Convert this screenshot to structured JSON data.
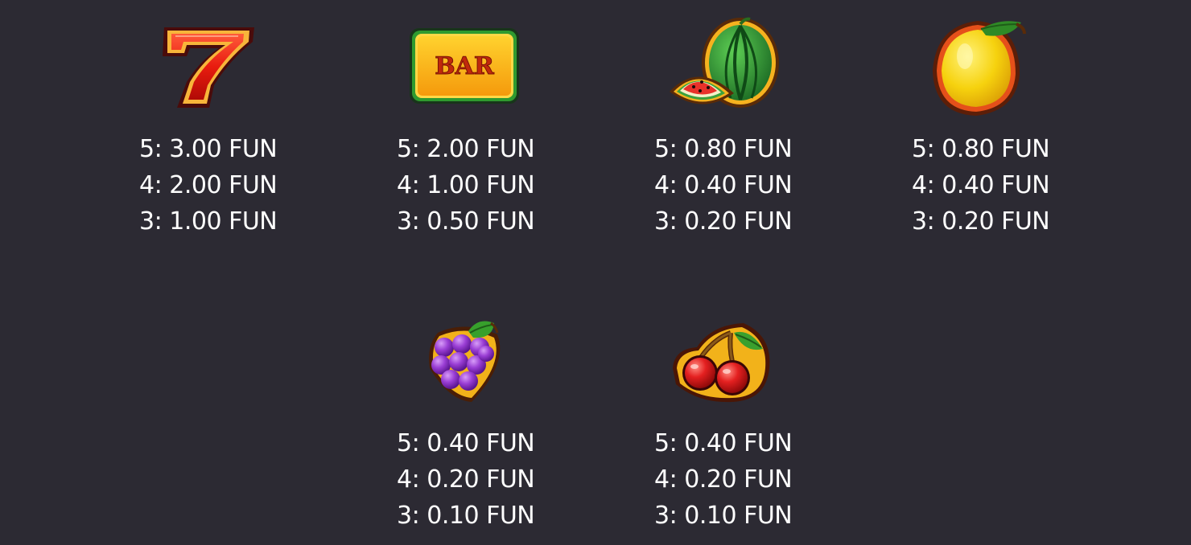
{
  "paytable": {
    "symbols": [
      {
        "icon": "seven-icon",
        "payouts": [
          "5: 3.00 FUN",
          "4: 2.00 FUN",
          "3: 1.00 FUN"
        ]
      },
      {
        "icon": "bar-icon",
        "label": "BAR",
        "payouts": [
          "5: 2.00 FUN",
          "4: 1.00 FUN",
          "3: 0.50 FUN"
        ]
      },
      {
        "icon": "watermelon-icon",
        "payouts": [
          "5: 0.80 FUN",
          "4: 0.40 FUN",
          "3: 0.20 FUN"
        ]
      },
      {
        "icon": "lemon-icon",
        "payouts": [
          "5: 0.80 FUN",
          "4: 0.40 FUN",
          "3: 0.20 FUN"
        ]
      },
      {
        "icon": "grapes-icon",
        "payouts": [
          "5: 0.40 FUN",
          "4: 0.20 FUN",
          "3: 0.10 FUN"
        ]
      },
      {
        "icon": "cherries-icon",
        "payouts": [
          "5: 0.40 FUN",
          "4: 0.20 FUN",
          "3: 0.10 FUN"
        ]
      }
    ]
  },
  "colors": {
    "background": "#2c2a33",
    "text": "#ffffff"
  }
}
